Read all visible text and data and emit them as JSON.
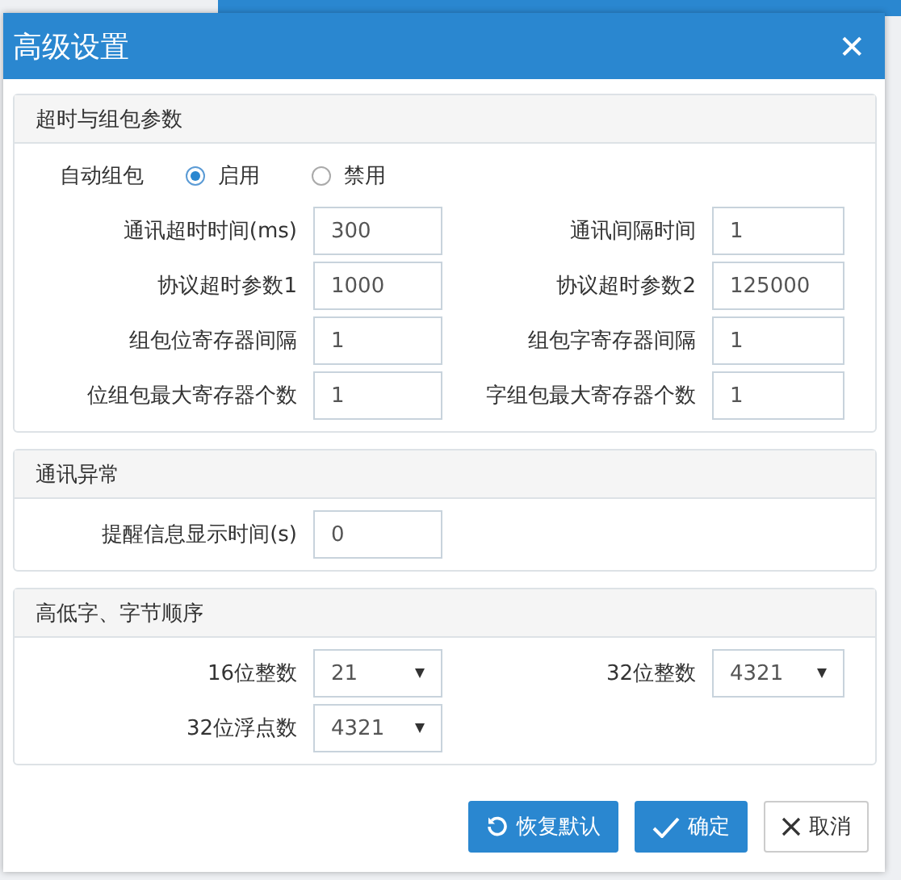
{
  "dialog": {
    "title": "高级设置",
    "close_label": "✕",
    "sections": [
      {
        "title": "超时与组包参数",
        "items": [
          {
            "kind": "radio",
            "label": "自动组包",
            "options": [
              {
                "label": "启用",
                "selected": true
              },
              {
                "label": "禁用",
                "selected": false
              }
            ]
          },
          {
            "kind": "input",
            "label": "通讯超时时间(ms)",
            "value": "300"
          },
          {
            "kind": "input",
            "label": "通讯间隔时间",
            "value": "1"
          },
          {
            "kind": "input",
            "label": "协议超时参数1",
            "value": "1000"
          },
          {
            "kind": "input",
            "label": "协议超时参数2",
            "value": "125000"
          },
          {
            "kind": "input",
            "label": "组包位寄存器间隔",
            "value": "1"
          },
          {
            "kind": "input",
            "label": "组包字寄存器间隔",
            "value": "1"
          },
          {
            "kind": "input",
            "label": "位组包最大寄存器个数",
            "value": "1"
          },
          {
            "kind": "input",
            "label": "字组包最大寄存器个数",
            "value": "1"
          }
        ]
      },
      {
        "title": "通讯异常",
        "items": [
          {
            "kind": "input",
            "label": "提醒信息显示时间(s)",
            "value": "0"
          }
        ]
      },
      {
        "title": "高低字、字节顺序",
        "items": [
          {
            "kind": "select",
            "label": "16位整数",
            "value": "21"
          },
          {
            "kind": "select",
            "label": "32位整数",
            "value": "4321"
          },
          {
            "kind": "select",
            "label": "32位浮点数",
            "value": "4321"
          }
        ]
      }
    ],
    "buttons": [
      {
        "label": "恢复默认",
        "kind": "reset"
      },
      {
        "label": "确定",
        "kind": "confirm"
      },
      {
        "label": "取消",
        "kind": "cancel"
      }
    ]
  }
}
